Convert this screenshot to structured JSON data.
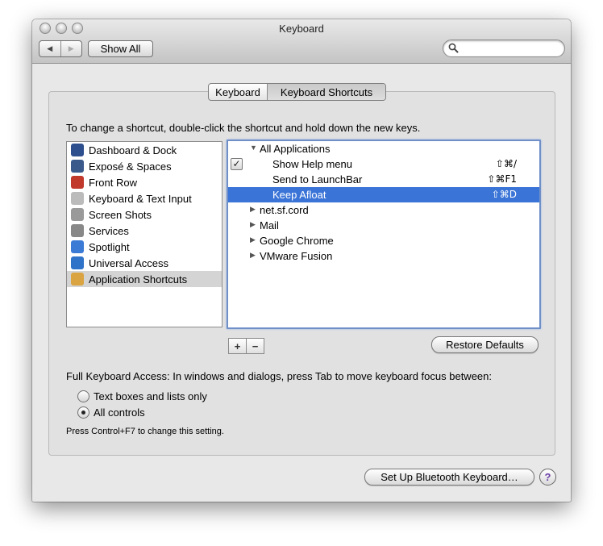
{
  "window": {
    "title": "Keyboard"
  },
  "toolbar": {
    "back_glyph": "◀",
    "forward_glyph": "▶",
    "show_all_label": "Show All",
    "search_placeholder": "",
    "search_value": ""
  },
  "tabs": [
    {
      "label": "Keyboard",
      "active": false
    },
    {
      "label": "Keyboard Shortcuts",
      "active": true
    }
  ],
  "instructions": "To change a shortcut, double-click the shortcut and hold down the new keys.",
  "categories": [
    {
      "label": "Dashboard & Dock",
      "icon": "dashboard-dock-icon",
      "color": "#2e4f8e",
      "selected": false
    },
    {
      "label": "Exposé & Spaces",
      "icon": "expose-spaces-icon",
      "color": "#3a5a8c",
      "selected": false
    },
    {
      "label": "Front Row",
      "icon": "front-row-icon",
      "color": "#c0392b",
      "selected": false
    },
    {
      "label": "Keyboard & Text Input",
      "icon": "keyboard-text-input-icon",
      "color": "#bbbbbb",
      "selected": false
    },
    {
      "label": "Screen Shots",
      "icon": "screen-shots-icon",
      "color": "#9a9a9a",
      "selected": false
    },
    {
      "label": "Services",
      "icon": "services-icon",
      "color": "#888888",
      "selected": false
    },
    {
      "label": "Spotlight",
      "icon": "spotlight-icon",
      "color": "#3b7bd6",
      "selected": false
    },
    {
      "label": "Universal Access",
      "icon": "universal-access-icon",
      "color": "#2f74c9",
      "selected": false
    },
    {
      "label": "Application Shortcuts",
      "icon": "application-shortcuts-icon",
      "color": "#d9a441",
      "selected": true
    }
  ],
  "shortcuts": [
    {
      "label": "All Applications",
      "level": 0,
      "disclosure": "▼",
      "key": "",
      "checked": null,
      "selected": false
    },
    {
      "label": "Show Help menu",
      "level": 1,
      "disclosure": "",
      "key": "⇧⌘/",
      "checked": true,
      "selected": false
    },
    {
      "label": "Send to LaunchBar",
      "level": 1,
      "disclosure": "",
      "key": "⇧⌘F1",
      "checked": null,
      "selected": false
    },
    {
      "label": "Keep Afloat",
      "level": 1,
      "disclosure": "",
      "key": "⇧⌘D",
      "checked": null,
      "selected": true
    },
    {
      "label": "net.sf.cord",
      "level": 0,
      "disclosure": "▶",
      "key": "",
      "checked": null,
      "selected": false
    },
    {
      "label": "Mail",
      "level": 0,
      "disclosure": "▶",
      "key": "",
      "checked": null,
      "selected": false
    },
    {
      "label": "Google Chrome",
      "level": 0,
      "disclosure": "▶",
      "key": "",
      "checked": null,
      "selected": false
    },
    {
      "label": "VMware Fusion",
      "level": 0,
      "disclosure": "▶",
      "key": "",
      "checked": null,
      "selected": false
    }
  ],
  "list_buttons": {
    "add": "+",
    "remove": "−"
  },
  "restore_defaults_label": "Restore Defaults",
  "full_keyboard_access": {
    "label": "Full Keyboard Access: In windows and dialogs, press Tab to move keyboard focus between:",
    "options": [
      {
        "label": "Text boxes and lists only",
        "selected": false
      },
      {
        "label": "All controls",
        "selected": true
      }
    ],
    "hint": "Press Control+F7 to change this setting."
  },
  "bluetooth_button_label": "Set Up Bluetooth Keyboard…",
  "help_label": "?"
}
